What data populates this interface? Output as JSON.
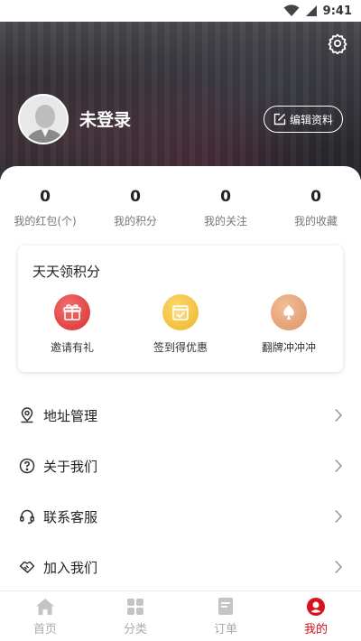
{
  "status_bar": {
    "time": "9:41"
  },
  "profile": {
    "username": "未登录",
    "edit_label": "编辑资料"
  },
  "stats": [
    {
      "value": "0",
      "label": "我的红包(个)"
    },
    {
      "value": "0",
      "label": "我的积分"
    },
    {
      "value": "0",
      "label": "我的关注"
    },
    {
      "value": "0",
      "label": "我的收藏"
    }
  ],
  "points_card": {
    "title": "天天领积分",
    "items": [
      {
        "label": "邀请有礼",
        "icon": "gift-icon"
      },
      {
        "label": "签到得优惠",
        "icon": "calendar-check-icon"
      },
      {
        "label": "翻牌冲冲冲",
        "icon": "spade-card-icon"
      }
    ]
  },
  "menu": [
    {
      "label": "地址管理",
      "icon": "location-pin-icon"
    },
    {
      "label": "关于我们",
      "icon": "question-circle-icon"
    },
    {
      "label": "联系客服",
      "icon": "headset-icon"
    },
    {
      "label": "加入我们",
      "icon": "handshake-icon"
    }
  ],
  "bottom_nav": [
    {
      "label": "首页",
      "icon": "home-icon"
    },
    {
      "label": "分类",
      "icon": "grid-icon"
    },
    {
      "label": "订单",
      "icon": "order-icon"
    },
    {
      "label": "我的",
      "icon": "profile-icon",
      "active": true
    }
  ],
  "colors": {
    "accent": "#d6121a",
    "gift": "#e84848",
    "checkin": "#f5c33b",
    "card": "#e8a57a"
  }
}
